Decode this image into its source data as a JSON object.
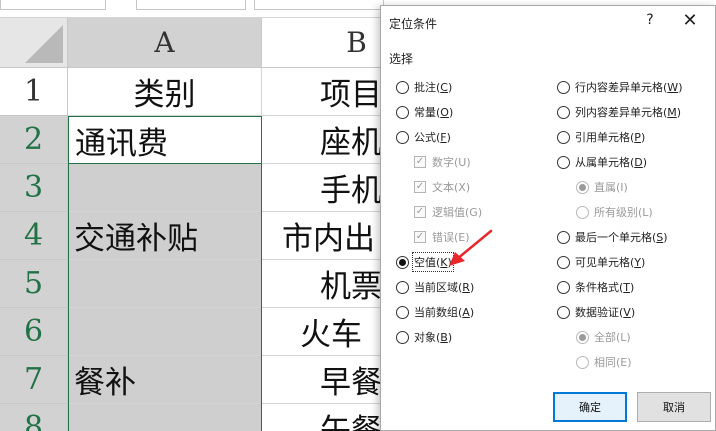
{
  "spreadsheet": {
    "columns": [
      "A",
      "B"
    ],
    "rows": [
      "1",
      "2",
      "3",
      "4",
      "5",
      "6",
      "7",
      "8"
    ],
    "cells": {
      "a1": "类别",
      "b1": "项目",
      "a2": "通讯费",
      "b2": "座机",
      "b3": "手机",
      "a4": "交通补贴",
      "b4": "市内出",
      "b5": "机票",
      "b6": "火车",
      "a7": "餐补",
      "b7": "早餐",
      "b8": "午餐"
    }
  },
  "dialog": {
    "title": "定位条件",
    "help": "?",
    "close": "✕",
    "group_label": "选择",
    "left_options": [
      {
        "label": "批注(",
        "key": "C",
        "tail": ")"
      },
      {
        "label": "常量(",
        "key": "O",
        "tail": ")"
      },
      {
        "label": "公式(",
        "key": "F",
        "tail": ")"
      },
      {
        "label": "数字(U)"
      },
      {
        "label": "文本(X)"
      },
      {
        "label": "逻辑值(G)"
      },
      {
        "label": "错误(E)"
      },
      {
        "label": "空值(",
        "key": "K",
        "tail": ")"
      },
      {
        "label": "当前区域(",
        "key": "R",
        "tail": ")"
      },
      {
        "label": "当前数组(",
        "key": "A",
        "tail": ")"
      },
      {
        "label": "对象(",
        "key": "B",
        "tail": ")"
      }
    ],
    "right_options": [
      {
        "label": "行内容差异单元格(",
        "key": "W",
        "tail": ")"
      },
      {
        "label": "列内容差异单元格(",
        "key": "M",
        "tail": ")"
      },
      {
        "label": "引用单元格(",
        "key": "P",
        "tail": ")"
      },
      {
        "label": "从属单元格(",
        "key": "D",
        "tail": ")"
      },
      {
        "label": "直属(I)"
      },
      {
        "label": "所有级别(L)"
      },
      {
        "label": "最后一个单元格(",
        "key": "S",
        "tail": ")"
      },
      {
        "label": "可见单元格(",
        "key": "Y",
        "tail": ")"
      },
      {
        "label": "条件格式(",
        "key": "T",
        "tail": ")"
      },
      {
        "label": "数据验证(",
        "key": "V",
        "tail": ")"
      },
      {
        "label": "全部(L)"
      },
      {
        "label": "相同(E)"
      }
    ],
    "selected_option": "空值(K)",
    "ok_label": "确定",
    "cancel_label": "取消"
  },
  "colors": {
    "selection_green": "#217346",
    "shade_gray": "#cfcfcf",
    "arrow_red": "#e8262b",
    "primary_blue": "#0078d7"
  }
}
